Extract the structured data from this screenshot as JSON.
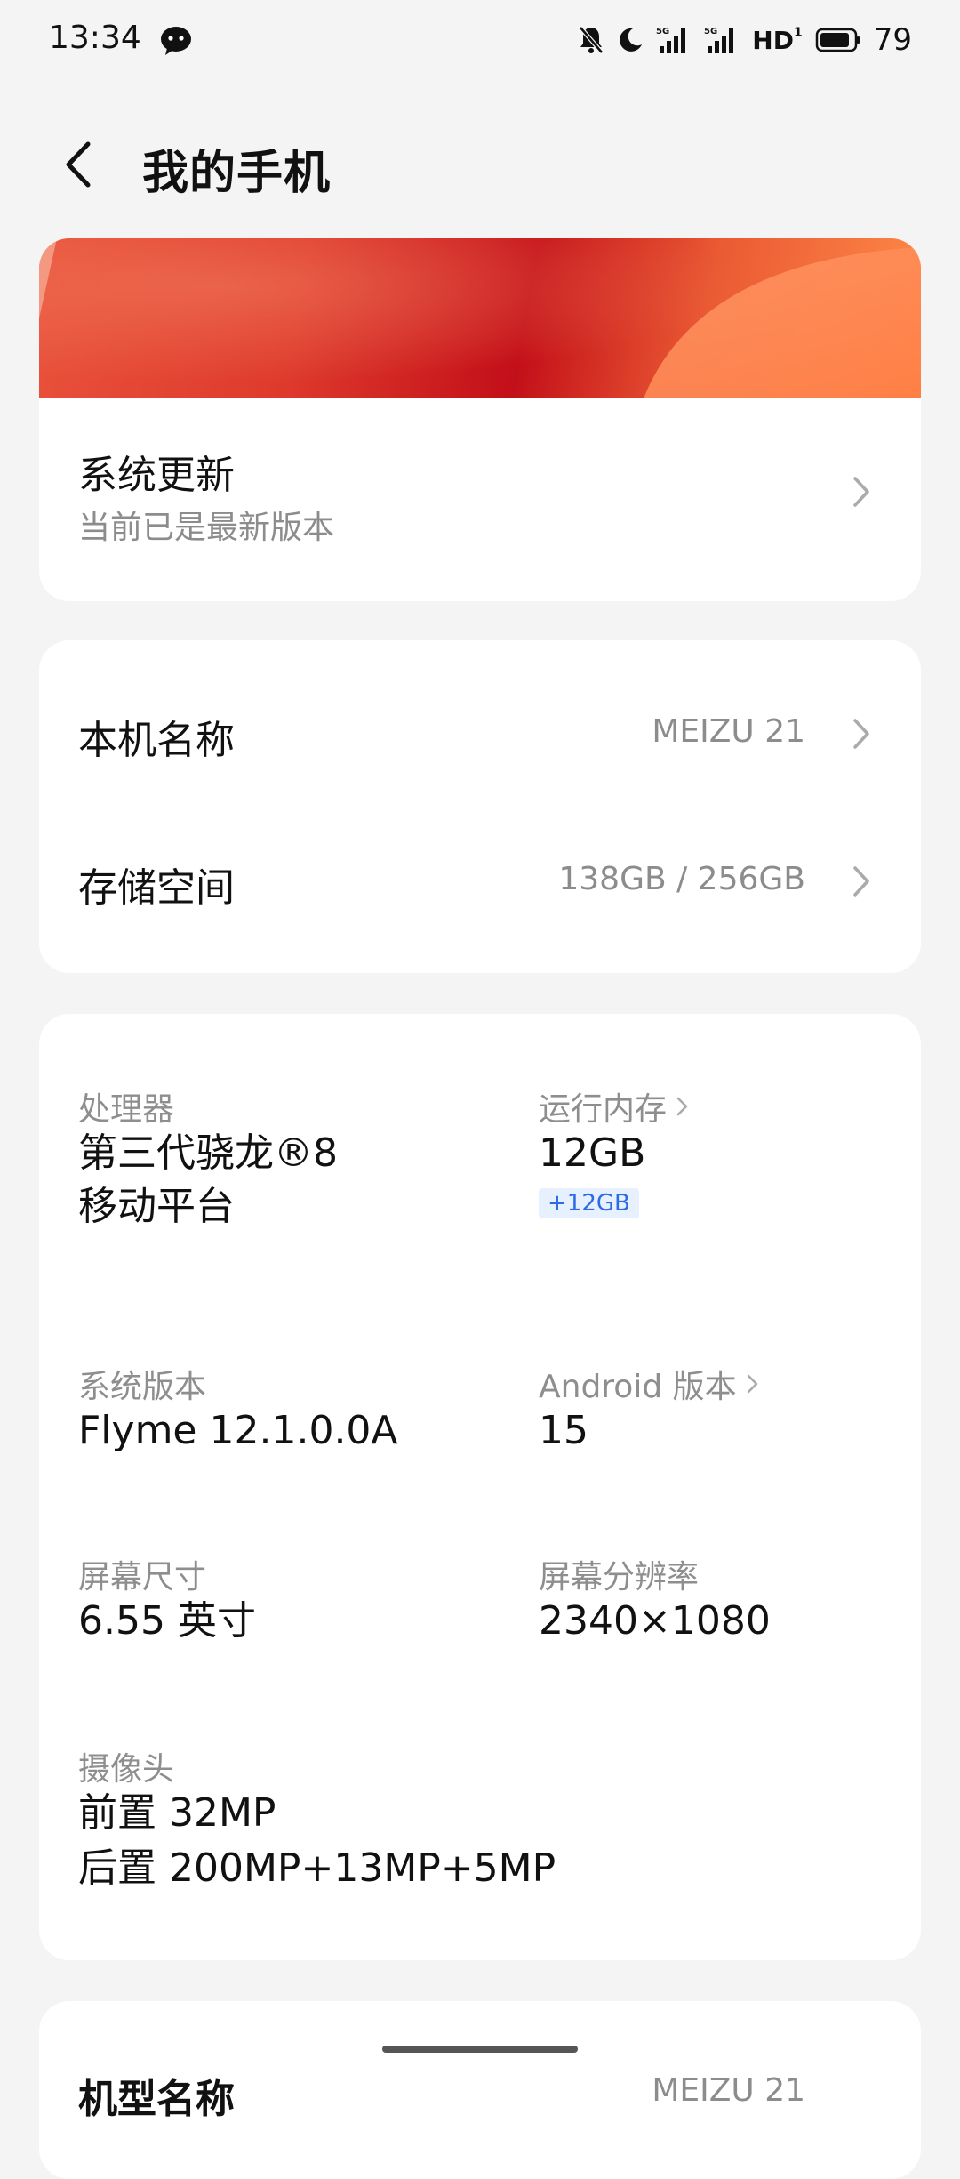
{
  "status_bar": {
    "time": "13:34",
    "battery": "79",
    "network_label": "HD"
  },
  "header": {
    "title": "我的手机"
  },
  "update_card": {
    "title": "系统更新",
    "subtitle": "当前已是最新版本"
  },
  "device_card": {
    "name_label": "本机名称",
    "name_value": "MEIZU 21",
    "storage_label": "存储空间",
    "storage_value": "138GB / 256GB"
  },
  "specs": {
    "processor_label": "处理器",
    "processor_line1": "第三代骁龙®8",
    "processor_line2": "移动平台",
    "ram_label": "运行内存",
    "ram_value": "12GB",
    "ram_extra": "+12GB",
    "os_label": "系统版本",
    "os_value": "Flyme 12.1.0.0A",
    "android_label": "Android 版本",
    "android_value": "15",
    "screen_size_label": "屏幕尺寸",
    "screen_size_value": "6.55 英寸",
    "resolution_label": "屏幕分辨率",
    "resolution_value": "2340×1080",
    "camera_label": "摄像头",
    "camera_front": "前置 32MP",
    "camera_rear": "后置 200MP+13MP+5MP"
  },
  "model_card": {
    "label": "机型名称",
    "value": "MEIZU 21"
  }
}
